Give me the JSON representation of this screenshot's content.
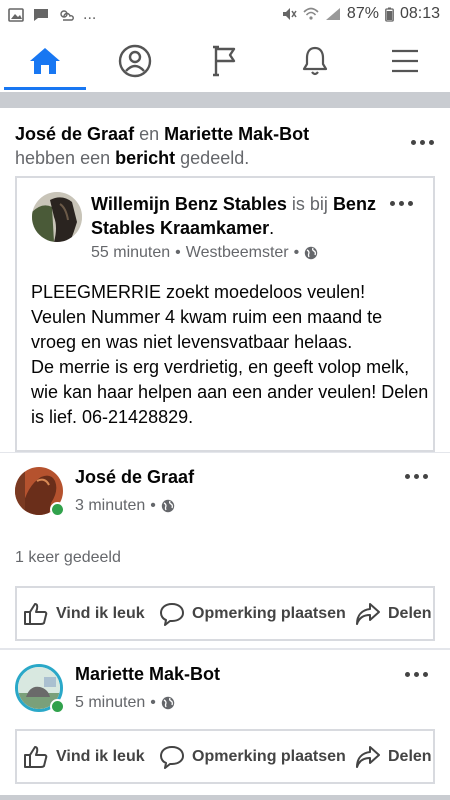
{
  "status_bar": {
    "notif_more": "...",
    "battery": "87%",
    "time": "08:13"
  },
  "nav": {
    "tabs": [
      {
        "icon": "home-icon",
        "active": true
      },
      {
        "icon": "profile-icon",
        "active": false
      },
      {
        "icon": "pages-flag-icon",
        "active": false
      },
      {
        "icon": "bell-icon",
        "active": false
      },
      {
        "icon": "menu-icon",
        "active": false
      }
    ]
  },
  "share_header": {
    "user1": "José de Graaf",
    "conj": "en",
    "user2": "Mariette Mak-Bot",
    "line2_pre": "hebben een",
    "line2_bold": "bericht",
    "line2_post": "gedeeld."
  },
  "embedded_post": {
    "author": "Willemijn Benz Stables",
    "is_at": "is bij",
    "place": "Benz Stables Kraamkamer",
    "period": ".",
    "time": "55 minuten",
    "location": "Westbeemster",
    "body": "PLEEGMERRIE zoekt moedeloos veulen!\nVeulen Nummer 4 kwam ruim een maand te vroeg en was niet levensvatbaar helaas.\nDe merrie is erg verdrietig, en geeft volop melk,  wie kan haar helpen aan een ander veulen! Delen is lief. 06-21428829."
  },
  "sharers": [
    {
      "name": "José de Graaf",
      "time": "3 minuten"
    },
    {
      "name": "Mariette Mak-Bot",
      "time": "5 minuten"
    }
  ],
  "share_count": "1 keer gedeeld",
  "actions": {
    "like": "Vind ik leuk",
    "comment": "Opmerking plaatsen",
    "share": "Delen"
  },
  "colors": {
    "accent": "#1877f2",
    "online": "#31a24c",
    "muted_text": "#65676b"
  }
}
